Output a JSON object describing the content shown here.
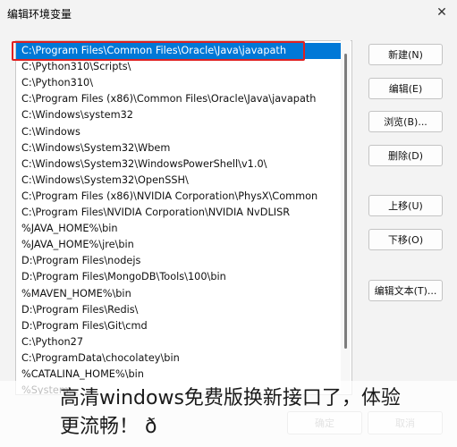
{
  "window": {
    "title": "编辑环境变量",
    "close_glyph": "✕"
  },
  "list": {
    "selected_index": 0,
    "items": [
      "C:\\Program Files\\Common Files\\Oracle\\Java\\javapath",
      "C:\\Python310\\Scripts\\",
      "C:\\Python310\\",
      "C:\\Program Files (x86)\\Common Files\\Oracle\\Java\\javapath",
      "C:\\Windows\\system32",
      "C:\\Windows",
      "C:\\Windows\\System32\\Wbem",
      "C:\\Windows\\System32\\WindowsPowerShell\\v1.0\\",
      "C:\\Windows\\System32\\OpenSSH\\",
      "C:\\Program Files (x86)\\NVIDIA Corporation\\PhysX\\Common",
      "C:\\Program Files\\NVIDIA Corporation\\NVIDIA NvDLISR",
      "%JAVA_HOME%\\bin",
      "%JAVA_HOME%\\jre\\bin",
      "D:\\Program Files\\nodejs",
      "D:\\Program Files\\MongoDB\\Tools\\100\\bin",
      "%MAVEN_HOME%\\bin",
      "D:\\Program Files\\Redis\\",
      "D:\\Program Files\\Git\\cmd",
      "C:\\Python27",
      "C:\\ProgramData\\chocolatey\\bin",
      "%CATALINA_HOME%\\bin",
      "%System..."
    ]
  },
  "buttons": {
    "new": "新建(N)",
    "edit": "编辑(E)",
    "browse": "浏览(B)...",
    "delete": "删除(D)",
    "move_up": "上移(U)",
    "move_down": "下移(O)",
    "edit_text": "编辑文本(T)..."
  },
  "footer": {
    "ok": "确定",
    "cancel": "取消"
  },
  "caption": {
    "line1": "高清windows免费版换新接口了，体验",
    "line2": "更流畅！ ð"
  },
  "colors": {
    "selection": "#0078d7",
    "highlight_box": "#e02020"
  }
}
